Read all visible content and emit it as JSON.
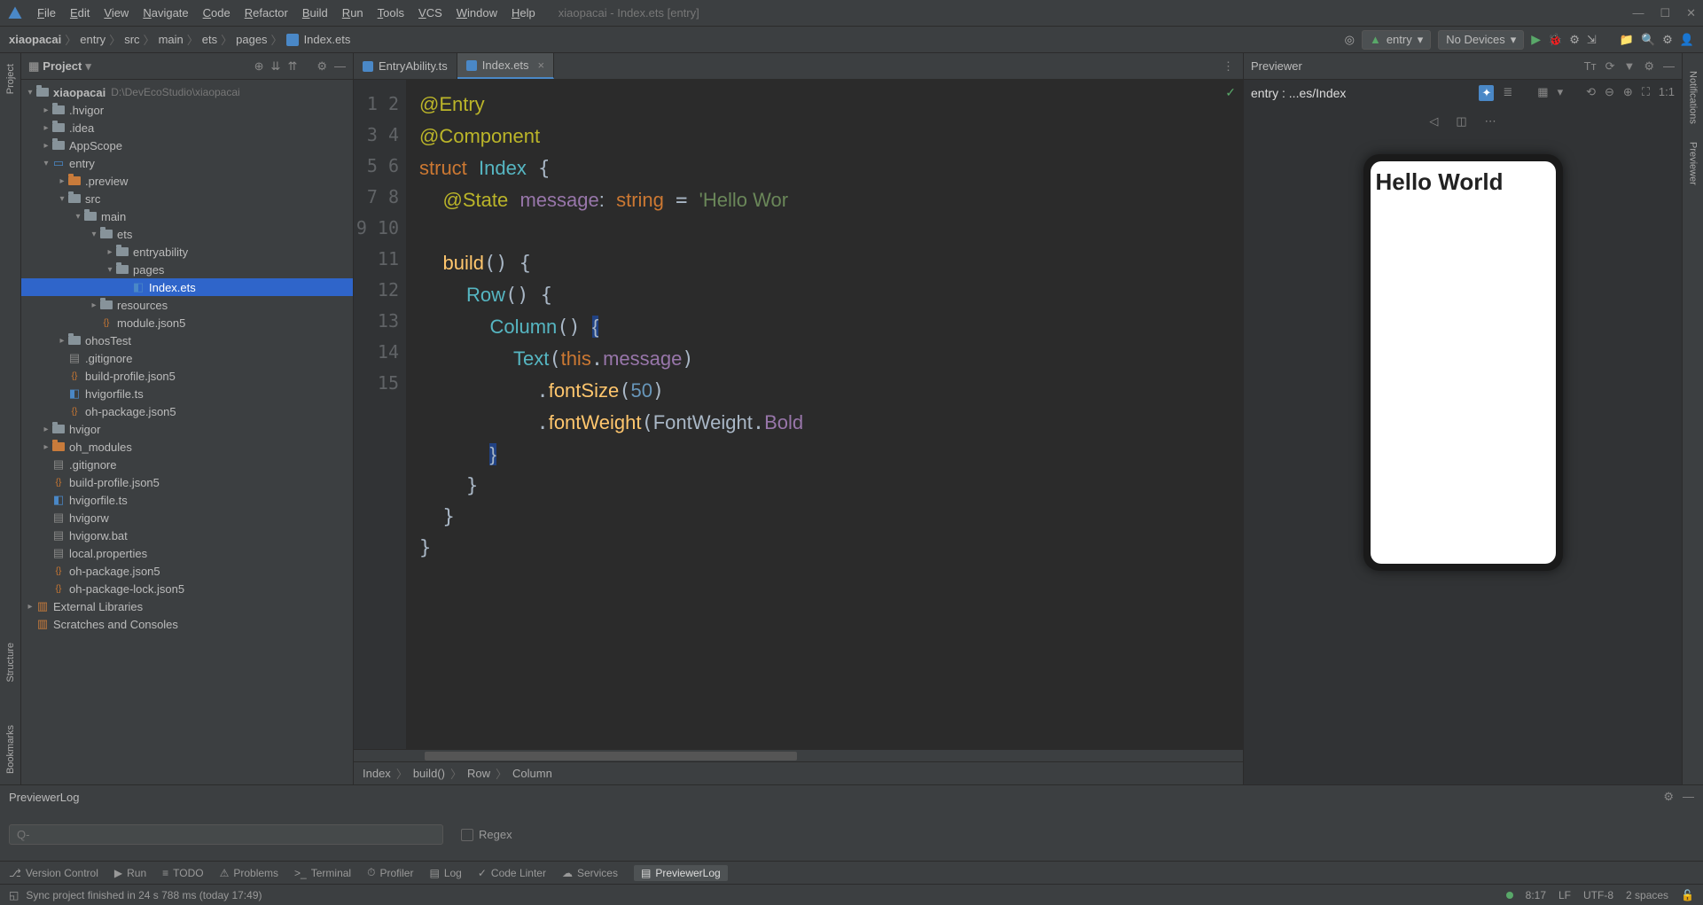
{
  "window": {
    "title": "xiaopacai - Index.ets [entry]"
  },
  "menus": [
    "File",
    "Edit",
    "View",
    "Navigate",
    "Code",
    "Refactor",
    "Build",
    "Run",
    "Tools",
    "VCS",
    "Window",
    "Help"
  ],
  "breadcrumb": [
    "xiaopacai",
    "entry",
    "src",
    "main",
    "ets",
    "pages",
    "Index.ets"
  ],
  "runConfig": {
    "module": "entry",
    "device": "No Devices"
  },
  "projectPane": {
    "label": "Project"
  },
  "tree": {
    "root": {
      "name": "xiaopacai",
      "hint": "D:\\DevEcoStudio\\xiaopacai"
    },
    "items": [
      {
        "indent": 1,
        "arrow": "▸",
        "icon": "folder",
        "name": ".hvigor"
      },
      {
        "indent": 1,
        "arrow": "▸",
        "icon": "folder",
        "name": ".idea"
      },
      {
        "indent": 1,
        "arrow": "▸",
        "icon": "folder",
        "name": "AppScope"
      },
      {
        "indent": 1,
        "arrow": "▾",
        "icon": "mod",
        "name": "entry"
      },
      {
        "indent": 2,
        "arrow": "▸",
        "icon": "folder-o",
        "name": ".preview"
      },
      {
        "indent": 2,
        "arrow": "▾",
        "icon": "folder",
        "name": "src"
      },
      {
        "indent": 3,
        "arrow": "▾",
        "icon": "folder",
        "name": "main"
      },
      {
        "indent": 4,
        "arrow": "▾",
        "icon": "folder",
        "name": "ets"
      },
      {
        "indent": 5,
        "arrow": "▸",
        "icon": "folder",
        "name": "entryability"
      },
      {
        "indent": 5,
        "arrow": "▾",
        "icon": "folder",
        "name": "pages"
      },
      {
        "indent": 6,
        "arrow": "",
        "icon": "ets",
        "name": "Index.ets",
        "selected": true
      },
      {
        "indent": 4,
        "arrow": "▸",
        "icon": "folder",
        "name": "resources"
      },
      {
        "indent": 4,
        "arrow": "",
        "icon": "json",
        "name": "module.json5"
      },
      {
        "indent": 2,
        "arrow": "▸",
        "icon": "folder",
        "name": "ohosTest"
      },
      {
        "indent": 2,
        "arrow": "",
        "icon": "file",
        "name": ".gitignore"
      },
      {
        "indent": 2,
        "arrow": "",
        "icon": "json",
        "name": "build-profile.json5"
      },
      {
        "indent": 2,
        "arrow": "",
        "icon": "ts",
        "name": "hvigorfile.ts"
      },
      {
        "indent": 2,
        "arrow": "",
        "icon": "json",
        "name": "oh-package.json5"
      },
      {
        "indent": 1,
        "arrow": "▸",
        "icon": "folder",
        "name": "hvigor"
      },
      {
        "indent": 1,
        "arrow": "▸",
        "icon": "folder-o",
        "name": "oh_modules"
      },
      {
        "indent": 1,
        "arrow": "",
        "icon": "file",
        "name": ".gitignore"
      },
      {
        "indent": 1,
        "arrow": "",
        "icon": "json",
        "name": "build-profile.json5"
      },
      {
        "indent": 1,
        "arrow": "",
        "icon": "ts",
        "name": "hvigorfile.ts"
      },
      {
        "indent": 1,
        "arrow": "",
        "icon": "file",
        "name": "hvigorw"
      },
      {
        "indent": 1,
        "arrow": "",
        "icon": "file",
        "name": "hvigorw.bat"
      },
      {
        "indent": 1,
        "arrow": "",
        "icon": "file",
        "name": "local.properties"
      },
      {
        "indent": 1,
        "arrow": "",
        "icon": "json",
        "name": "oh-package.json5"
      },
      {
        "indent": 1,
        "arrow": "",
        "icon": "json",
        "name": "oh-package-lock.json5"
      }
    ],
    "extLibs": "External Libraries",
    "scratches": "Scratches and Consoles"
  },
  "tabs": [
    {
      "name": "EntryAbility.ts",
      "active": false
    },
    {
      "name": "Index.ets",
      "active": true
    }
  ],
  "code": {
    "lines": [
      "1",
      "2",
      "3",
      "4",
      "5",
      "6",
      "7",
      "8",
      "9",
      "10",
      "11",
      "12",
      "13",
      "14",
      "15"
    ],
    "entry": "@Entry",
    "component": "@Component",
    "struct": "struct",
    "indexName": "Index",
    "state": "@State",
    "msgVar": "message",
    "typeSep": ":",
    "stringType": "string",
    "eq": "=",
    "msgVal": "'Hello Wor",
    "build": "build",
    "row": "Row",
    "column": "Column",
    "text": "Text",
    "thisKw": "this",
    "msgProp": "message",
    "fontSize": "fontSize",
    "fifty": "50",
    "fontWeight": "fontWeight",
    "fwClass": "FontWeight",
    "bold": "Bold"
  },
  "codeBreadcrumb": [
    "Index",
    "build()",
    "Row",
    "Column"
  ],
  "previewer": {
    "title": "Previewer",
    "entry": "entry : ...es/Index",
    "helloWorld": "Hello World"
  },
  "log": {
    "title": "PreviewerLog",
    "searchPrefix": "Q-",
    "regex": "Regex"
  },
  "toolWindows": [
    "Version Control",
    "Run",
    "TODO",
    "Problems",
    "Terminal",
    "Profiler",
    "Log",
    "Code Linter",
    "Services",
    "PreviewerLog"
  ],
  "status": {
    "msg": "Sync project finished in 24 s 788 ms (today 17:49)",
    "pos": "8:17",
    "eol": "LF",
    "enc": "UTF-8",
    "indent": "2 spaces"
  },
  "leftRail": [
    "Project",
    "Structure",
    "Bookmarks"
  ],
  "rightRail": [
    "Notifications",
    "Previewer"
  ]
}
